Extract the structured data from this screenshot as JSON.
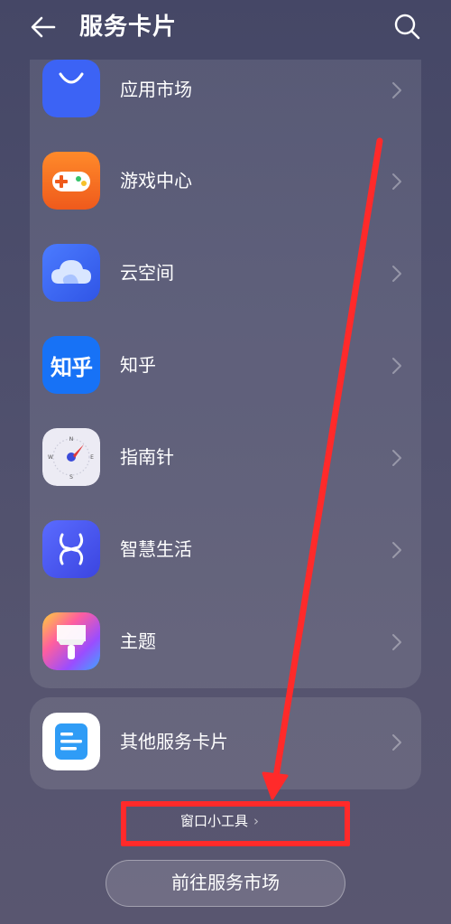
{
  "header": {
    "title": "服务卡片",
    "back_icon": "arrow-left-icon",
    "search_icon": "search-icon"
  },
  "apps": [
    {
      "label": "应用市场",
      "icon": "app-market-icon",
      "color": "#3c63f5"
    },
    {
      "label": "游戏中心",
      "icon": "game-center-icon",
      "color": "#f26a22"
    },
    {
      "label": "云空间",
      "icon": "cloud-space-icon",
      "color": "#3d6df3"
    },
    {
      "label": "知乎",
      "icon": "zhihu-icon",
      "icon_text": "知乎",
      "color": "#1772f6"
    },
    {
      "label": "指南针",
      "icon": "compass-icon",
      "color": "#e9e9f3"
    },
    {
      "label": "智慧生活",
      "icon": "smart-life-icon",
      "color": "#4758f0"
    },
    {
      "label": "主题",
      "icon": "theme-icon",
      "color": "#ff4fa0"
    }
  ],
  "other": {
    "label": "其他服务卡片",
    "icon": "other-cards-icon",
    "color": "#2f9cf6"
  },
  "widgets_link": "窗口小工具",
  "cta_button": "前往服务市场",
  "annotation_color": "#ff2a2a"
}
